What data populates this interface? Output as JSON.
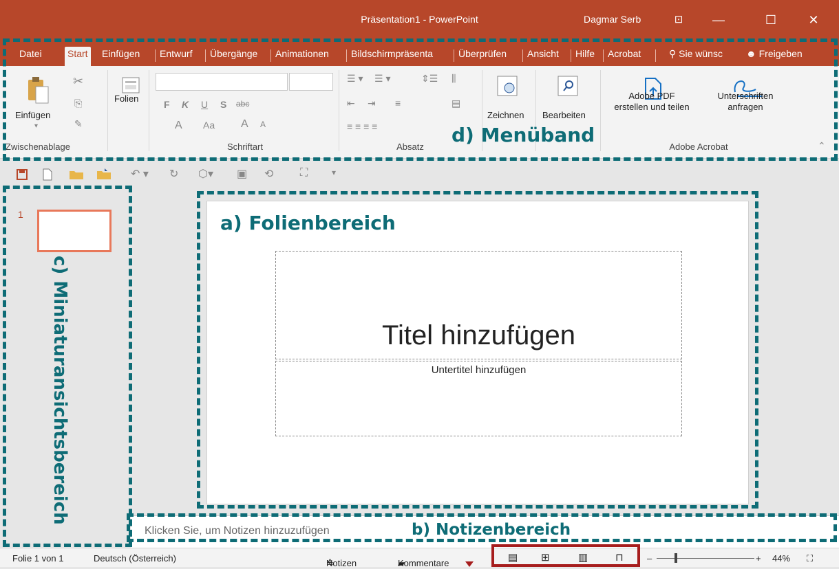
{
  "window": {
    "title": "Präsentation1 - PowerPoint",
    "user": "Dagmar Serb",
    "ribbon_display_icon": "⊡",
    "minimize": "—",
    "maximize": "☐",
    "close": "✕"
  },
  "tabs": [
    {
      "label": "Datei"
    },
    {
      "label": "Start",
      "active": true
    },
    {
      "label": "Einfügen"
    },
    {
      "label": "Entwurf"
    },
    {
      "label": "Übergänge"
    },
    {
      "label": "Animationen"
    },
    {
      "label": "Bildschirmpräsenta"
    },
    {
      "label": "Überprüfen"
    },
    {
      "label": "Ansicht"
    },
    {
      "label": "Hilfe"
    },
    {
      "label": "Acrobat"
    }
  ],
  "tell_me": "Sie wünsc",
  "share": "Freigeben",
  "ribbon": {
    "clipboard": {
      "paste": "Einfügen",
      "group": "Zwischenablage"
    },
    "slides": {
      "new_slide": "Folien"
    },
    "font": {
      "group": "Schriftart",
      "bold": "F",
      "italic": "K",
      "underline": "U",
      "shadow": "S",
      "strike": "abc",
      "grow": "A",
      "shrink": "A",
      "case": "Aa"
    },
    "paragraph": {
      "group": "Absatz"
    },
    "drawing": {
      "label": "Zeichnen"
    },
    "editing": {
      "label": "Bearbeiten"
    },
    "acrobat": {
      "pdf_line1": "Adobe PDF",
      "pdf_line2": "erstellen und teilen",
      "sign_line1": "Unterschriften",
      "sign_line2": "anfragen",
      "group": "Adobe Acrobat"
    }
  },
  "thumbnails": [
    {
      "number": "1"
    }
  ],
  "slide": {
    "title_placeholder": "Titel hinzufügen",
    "subtitle_placeholder": "Untertitel hinzufügen"
  },
  "notes": {
    "placeholder": "Klicken Sie, um Notizen hinzuzufügen"
  },
  "status": {
    "slide_info": "Folie 1 von 1",
    "language": "Deutsch (Österreich)",
    "notes_btn": "Notizen",
    "comments_btn": "Kommentare",
    "zoom": "44%",
    "zoom_minus": "–",
    "zoom_plus": "+"
  },
  "annotations": {
    "a": "a) Folienbereich",
    "b": "b) Notizenbereich",
    "c": "c) Miniaturansichtsbereich",
    "d": "d) Menüband"
  },
  "colors": {
    "accent": "#b7472a",
    "annotation": "#0e6c76",
    "highlight": "#a61d1d"
  }
}
